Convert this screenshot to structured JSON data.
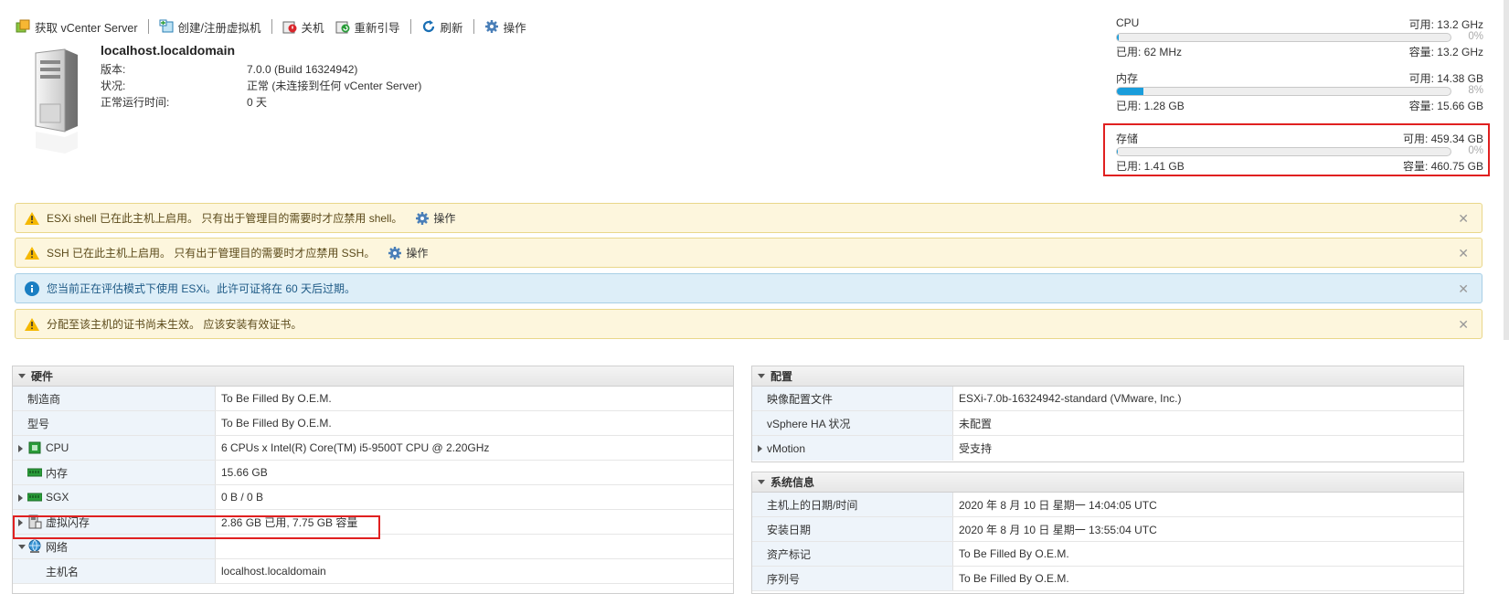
{
  "toolbar": {
    "items": [
      {
        "label": "获取 vCenter Server",
        "icon": "vcenter-icon"
      },
      {
        "label": "创建/注册虚拟机",
        "icon": "create-vm-icon"
      },
      {
        "label": "关机",
        "icon": "shutdown-icon"
      },
      {
        "label": "重新引导",
        "icon": "reboot-icon"
      },
      {
        "label": "刷新",
        "icon": "refresh-icon"
      },
      {
        "label": "操作",
        "icon": "gear-icon"
      }
    ]
  },
  "host": {
    "name": "localhost.localdomain",
    "info": [
      {
        "key": "版本:",
        "value": "7.0.0 (Build 16324942)"
      },
      {
        "key": "状况:",
        "value": "正常 (未连接到任何 vCenter Server)"
      },
      {
        "key": "正常运行时间:",
        "value": "0 天"
      }
    ]
  },
  "resources": {
    "cpu": {
      "label": "CPU",
      "free": "可用: 13.2 GHz",
      "pct_label": "0%",
      "used": "已用: 62 MHz",
      "capacity": "容量: 13.2 GHz",
      "fraction": 0.005
    },
    "memory": {
      "label": "内存",
      "free": "可用: 14.38 GB",
      "pct_label": "8%",
      "used": "已用: 1.28 GB",
      "capacity": "容量: 15.66 GB",
      "fraction": 0.08
    },
    "storage": {
      "label": "存储",
      "free": "可用: 459.34 GB",
      "pct_label": "0%",
      "used": "已用: 1.41 GB",
      "capacity": "容量: 460.75 GB",
      "fraction": 0.003
    },
    "bar_color": "#1a9ddb"
  },
  "alerts": [
    {
      "type": "warning",
      "text": "ESXi shell 已在此主机上启用。 只有出于管理目的需要时才应禁用 shell。",
      "action": "操作"
    },
    {
      "type": "warning",
      "text": "SSH 已在此主机上启用。 只有出于管理目的需要时才应禁用 SSH。",
      "action": "操作"
    },
    {
      "type": "info",
      "text": "您当前正在评估模式下使用 ESXi。此许可证将在 60 天后过期。"
    },
    {
      "type": "warning",
      "text": "分配至该主机的证书尚未生效。 应该安装有效证书。"
    }
  ],
  "hardware": {
    "title": "硬件",
    "rows": [
      {
        "key": "制造商",
        "value": "To Be Filled By O.E.M."
      },
      {
        "key": "型号",
        "value": "To Be Filled By O.E.M."
      },
      {
        "key": "CPU",
        "value": "6 CPUs x Intel(R) Core(TM) i5-9500T CPU @ 2.20GHz"
      },
      {
        "key": "内存",
        "value": "15.66 GB"
      },
      {
        "key": "SGX",
        "value": "0 B / 0 B"
      },
      {
        "key": "虚拟闪存",
        "value": "2.86 GB 已用, 7.75 GB 容量"
      },
      {
        "key": "网络",
        "value": ""
      },
      {
        "key": "主机名",
        "value": "localhost.localdomain"
      }
    ]
  },
  "configuration": {
    "title": "配置",
    "rows": [
      {
        "key": "映像配置文件",
        "value": "ESXi-7.0b-16324942-standard (VMware, Inc.)"
      },
      {
        "key": "vSphere HA 状况",
        "value": "未配置"
      },
      {
        "key": "vMotion",
        "value": "受支持"
      }
    ]
  },
  "system_info": {
    "title": "系统信息",
    "rows": [
      {
        "key": "主机上的日期/时间",
        "value": "2020 年 8 月 10 日 星期一 14:04:05 UTC"
      },
      {
        "key": "安装日期",
        "value": "2020 年 8 月 10 日 星期一 13:55:04 UTC"
      },
      {
        "key": "资产标记",
        "value": "To Be Filled By O.E.M."
      },
      {
        "key": "序列号",
        "value": "To Be Filled By O.E.M."
      }
    ]
  }
}
